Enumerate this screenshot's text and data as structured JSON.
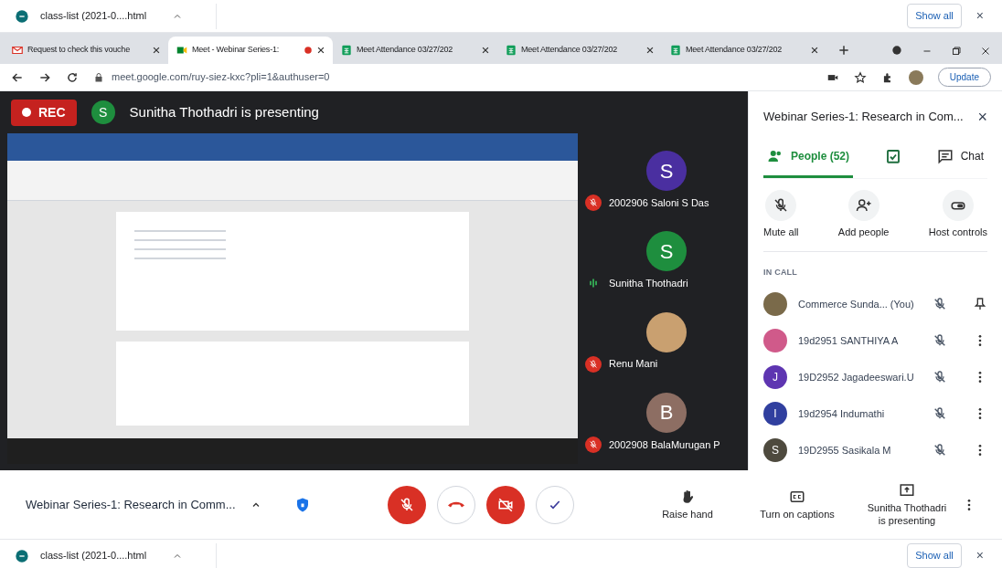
{
  "top_download_bar": {
    "file": "class-list (2021-0....html",
    "show_all": "Show all",
    "close": "×"
  },
  "tabs": [
    {
      "label": "Request to check this vouche",
      "kind": "mail",
      "selected": false
    },
    {
      "label": "Meet - Webinar Series-1:",
      "kind": "meet",
      "selected": true
    },
    {
      "label": "Meet Attendance 03/27/202",
      "kind": "sheet",
      "selected": false
    },
    {
      "label": "Meet Attendance 03/27/202",
      "kind": "sheet",
      "selected": false
    },
    {
      "label": "Meet Attendance 03/27/202",
      "kind": "sheet",
      "selected": false
    }
  ],
  "address_bar": {
    "url": "meet.google.com/ruy-siez-kxc?pli=1&authuser=0",
    "update": "Update"
  },
  "meeting": {
    "rec": "REC",
    "presenter_initial": "S",
    "presenting": "Sunitha Thothadri is presenting",
    "tiles": [
      {
        "name": "2002906 Saloni S Das",
        "initial": "S",
        "kind": "letter",
        "color": "#4a2fa0",
        "muted": true
      },
      {
        "name": "Sunitha Thothadri",
        "initial": "S",
        "kind": "letter",
        "color": "#1e8e3e",
        "muted": false
      },
      {
        "name": "Renu Mani",
        "kind": "photo",
        "color": "#c9a070",
        "muted": true
      },
      {
        "name": "2002908 BalaMurugan P",
        "initial": "B",
        "kind": "letter",
        "color": "#8d6e63",
        "muted": true
      }
    ]
  },
  "side_panel": {
    "title": "Webinar Series-1: Research in Com...",
    "close": "×",
    "tabs": [
      {
        "label": "People (52)",
        "kind": "people",
        "selected": true
      },
      {
        "kind": "activities",
        "selected": false
      },
      {
        "label": "Chat",
        "kind": "chat",
        "selected": false
      }
    ],
    "actions": [
      {
        "label": "Mute all",
        "kind": "mute"
      },
      {
        "label": "Add people",
        "kind": "add"
      },
      {
        "label": "Host controls",
        "kind": "host"
      }
    ],
    "section": "IN CALL",
    "people": [
      {
        "name": "Commerce Sunda... (You)",
        "kind": "photo",
        "color": "#7a6a4a",
        "pinned": true
      },
      {
        "name": "19d2951 SANTHIYA A",
        "kind": "photo",
        "color": "#d05a8a",
        "pinned": false
      },
      {
        "name": "19D2952 Jagadeeswari.U",
        "kind": "letter",
        "initial": "J",
        "color": "#5e35b1",
        "pinned": false
      },
      {
        "name": "19d2954 Indumathi",
        "kind": "letter",
        "initial": "I",
        "color": "#303f9f",
        "pinned": false
      },
      {
        "name": "19D2955 Sasikala M",
        "kind": "letter",
        "initial": "S",
        "color": "#4e4a3e",
        "pinned": false
      }
    ]
  },
  "bottom_bar": {
    "meeting_title": "Webinar Series-1: Research in Comm...",
    "controls": [
      {
        "label": "Raise hand",
        "kind": "hand"
      },
      {
        "label": "Turn on captions",
        "kind": "cc"
      },
      {
        "label": "Sunitha Thothadri is presenting",
        "kind": "present"
      }
    ]
  },
  "bottom_download_bar": {
    "file": "class-list (2021-0....html",
    "show_all": "Show all",
    "close": "×"
  }
}
